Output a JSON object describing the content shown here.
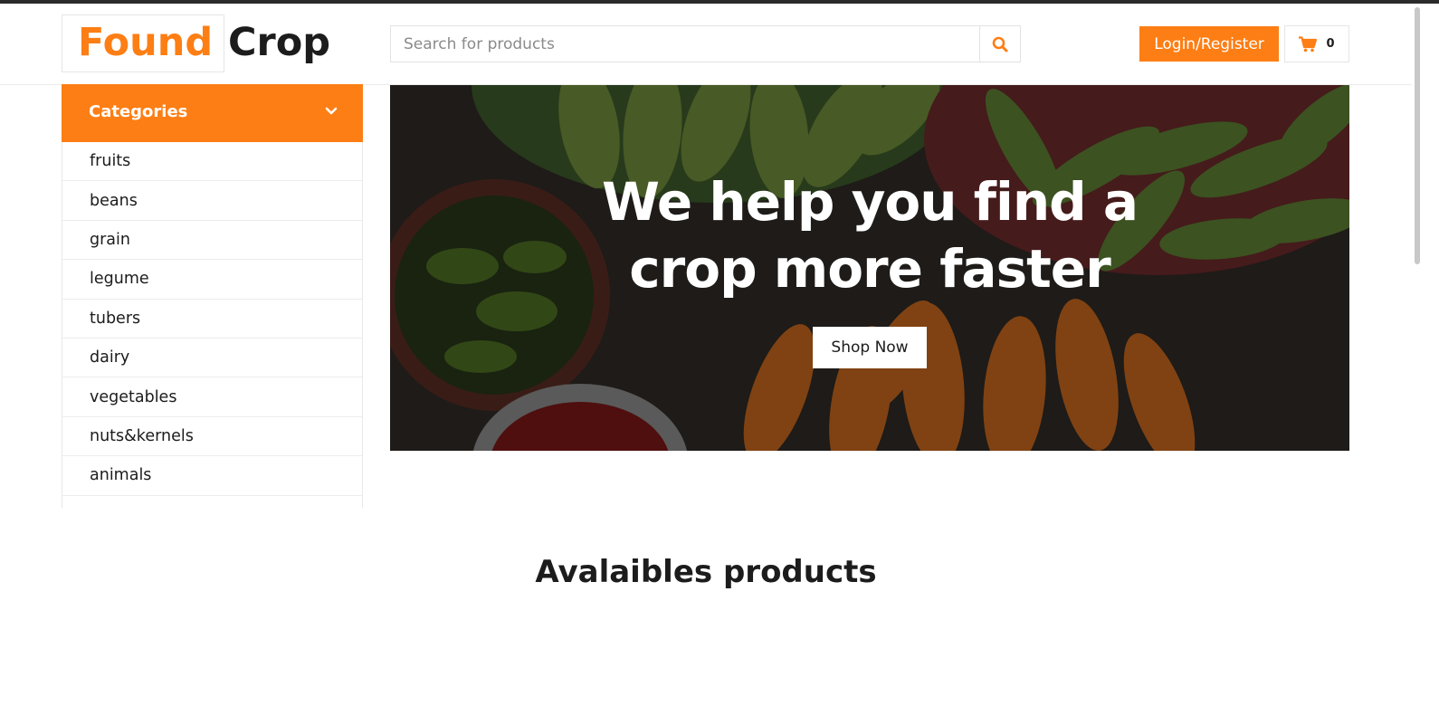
{
  "header": {
    "logo_primary": "Found",
    "logo_secondary": "Crop",
    "search_placeholder": "Search for products",
    "login_label": "Login/Register",
    "cart_count": "0"
  },
  "sidebar": {
    "title": "Categories",
    "items": [
      {
        "label": "fruits"
      },
      {
        "label": "beans"
      },
      {
        "label": "grain"
      },
      {
        "label": "legume"
      },
      {
        "label": "tubers"
      },
      {
        "label": "dairy"
      },
      {
        "label": "vegetables"
      },
      {
        "label": "nuts&kernels"
      },
      {
        "label": "animals"
      }
    ]
  },
  "hero": {
    "title_line1": "We help you find a",
    "title_line2": "crop more faster",
    "button_label": "Shop Now"
  },
  "main": {
    "section_title": "Avalaibles products"
  },
  "colors": {
    "accent": "#fd7e14",
    "text": "#1c1c1c"
  },
  "icons": {
    "search": "search-icon",
    "cart": "cart-icon",
    "chevron": "chevron-down-icon"
  }
}
